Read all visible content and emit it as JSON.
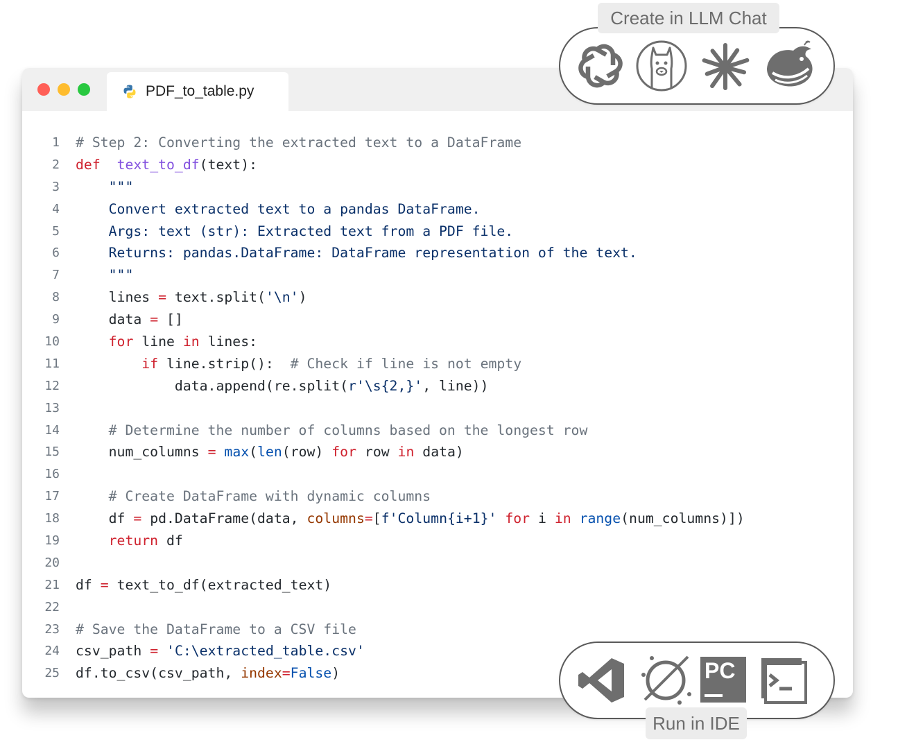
{
  "window": {
    "tab": {
      "filename": "PDF_to_table.py",
      "icon": "python-icon"
    },
    "traffic_lights": {
      "close": "#ff5f57",
      "minimize": "#febc2e",
      "zoom": "#28c840"
    }
  },
  "code": {
    "language": "python",
    "lines": [
      [
        [
          "cm",
          "# Step 2: Converting the extracted text to a DataFrame"
        ]
      ],
      [
        [
          "kw",
          "def"
        ],
        [
          "",
          "  "
        ],
        [
          "fn",
          "text_to_df"
        ],
        [
          "",
          "(text):"
        ]
      ],
      [
        [
          "",
          "    "
        ],
        [
          "st",
          "\"\"\""
        ]
      ],
      [
        [
          "",
          "    "
        ],
        [
          "st",
          "Convert extracted text to a pandas DataFrame."
        ]
      ],
      [
        [
          "",
          "    "
        ],
        [
          "st",
          "Args: text (str): Extracted text from a PDF file."
        ]
      ],
      [
        [
          "",
          "    "
        ],
        [
          "st",
          "Returns: pandas.DataFrame: DataFrame representation of the text."
        ]
      ],
      [
        [
          "",
          "    "
        ],
        [
          "st",
          "\"\"\""
        ]
      ],
      [
        [
          "",
          "    lines "
        ],
        [
          "op",
          "="
        ],
        [
          "",
          " text.split("
        ],
        [
          "st",
          "'\\n'"
        ],
        [
          "",
          ")"
        ]
      ],
      [
        [
          "",
          "    data "
        ],
        [
          "op",
          "="
        ],
        [
          "",
          " []"
        ]
      ],
      [
        [
          "",
          "    "
        ],
        [
          "kw",
          "for"
        ],
        [
          "",
          " line "
        ],
        [
          "kw",
          "in"
        ],
        [
          "",
          " lines:"
        ]
      ],
      [
        [
          "",
          "        "
        ],
        [
          "kw",
          "if"
        ],
        [
          "",
          " line.strip():  "
        ],
        [
          "cm",
          "# Check if line is not empty"
        ]
      ],
      [
        [
          "",
          "            data.append(re.split("
        ],
        [
          "st",
          "r'\\s{2,}'"
        ],
        [
          "",
          ", line))"
        ]
      ],
      [],
      [
        [
          "",
          "    "
        ],
        [
          "cm",
          "# Determine the number of columns based on the longest row"
        ]
      ],
      [
        [
          "",
          "    num_columns "
        ],
        [
          "op",
          "="
        ],
        [
          "",
          " "
        ],
        [
          "bi",
          "max"
        ],
        [
          "",
          "("
        ],
        [
          "bi",
          "len"
        ],
        [
          "",
          "(row) "
        ],
        [
          "kw",
          "for"
        ],
        [
          "",
          " row "
        ],
        [
          "kw",
          "in"
        ],
        [
          "",
          " data)"
        ]
      ],
      [],
      [
        [
          "",
          "    "
        ],
        [
          "cm",
          "# Create DataFrame with dynamic columns"
        ]
      ],
      [
        [
          "",
          "    df "
        ],
        [
          "op",
          "="
        ],
        [
          "",
          " pd.DataFrame(data, "
        ],
        [
          "pa",
          "columns"
        ],
        [
          "op",
          "="
        ],
        [
          "",
          "["
        ],
        [
          "st",
          "f'Column{i+1}'"
        ],
        [
          "",
          " "
        ],
        [
          "kw",
          "for"
        ],
        [
          "",
          " i "
        ],
        [
          "kw",
          "in"
        ],
        [
          "",
          " "
        ],
        [
          "bi",
          "range"
        ],
        [
          "",
          "(num_columns)])"
        ]
      ],
      [
        [
          "",
          "    "
        ],
        [
          "kw",
          "return"
        ],
        [
          "",
          " df"
        ]
      ],
      [],
      [
        [
          "",
          "df "
        ],
        [
          "op",
          "="
        ],
        [
          "",
          " text_to_df(extracted_text)"
        ]
      ],
      [],
      [
        [
          "cm",
          "# Save the DataFrame to a CSV file"
        ]
      ],
      [
        [
          "",
          "csv_path "
        ],
        [
          "op",
          "="
        ],
        [
          "",
          " "
        ],
        [
          "st",
          "'C:\\extracted_table.csv'"
        ]
      ],
      [
        [
          "",
          "df.to_csv(csv_path, "
        ],
        [
          "pa",
          "index"
        ],
        [
          "op",
          "="
        ],
        [
          "bi",
          "False"
        ],
        [
          "",
          ")"
        ]
      ]
    ]
  },
  "llm_chat": {
    "label": "Create in LLM Chat",
    "icons": [
      "chatgpt-icon",
      "llama-icon",
      "claude-icon",
      "deepseek-icon"
    ]
  },
  "ide": {
    "label": "Run in IDE",
    "icons": [
      "vscode-icon",
      "eclipse-icon",
      "pycharm-icon",
      "terminal-icon"
    ],
    "pycharm_text": "PC"
  }
}
